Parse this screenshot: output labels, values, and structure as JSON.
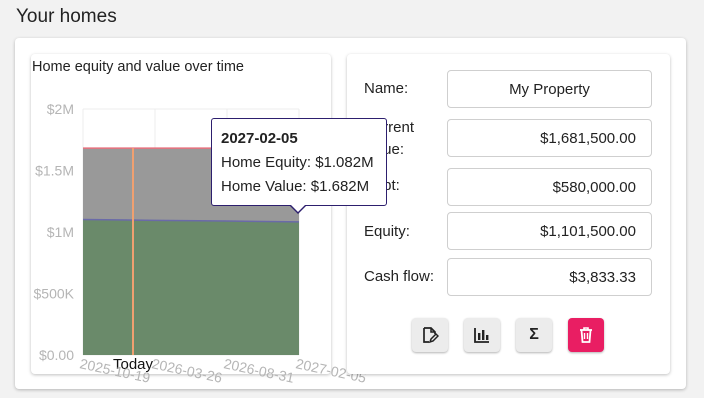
{
  "page": {
    "title": "Your homes"
  },
  "chart_data": {
    "type": "area",
    "title": "Home equity and value over time",
    "x": [
      "2025-10-19",
      "2026-03-26",
      "2026-08-31",
      "2027-02-05"
    ],
    "series": [
      {
        "name": "Home Equity",
        "values": [
          1101500,
          1095000,
          1089000,
          1082000
        ],
        "color": "#6a8a6a"
      },
      {
        "name": "Home Value",
        "values": [
          1681500,
          1681500,
          1681500,
          1682000
        ],
        "color": "#999999"
      }
    ],
    "yticks": [
      "$0.00",
      "$500K",
      "$1M",
      "$1.5M",
      "$2M"
    ],
    "ylim": [
      0,
      2000000
    ],
    "today_marker": {
      "label": "Today",
      "x": "2025-10-19",
      "color": "#f0a070"
    },
    "value_line_color": "#e8707e",
    "equity_line_color": "#6a6aa8",
    "tooltip": {
      "date": "2027-02-05",
      "equity": "Home Equity: $1.082M",
      "value": "Home Value: $1.682M"
    }
  },
  "form": {
    "name_label": "Name:",
    "name_value": "My Property",
    "current_value_label_line1": "Current",
    "current_value_label_line2": "value:",
    "current_value": "$1,681,500.00",
    "debt_label": "Debt:",
    "debt_value": "$580,000.00",
    "equity_label": "Equity:",
    "equity_value": "$1,101,500.00",
    "cashflow_label": "Cash flow:",
    "cashflow_value": "$3,833.33"
  },
  "actions": {
    "edit_icon": "edit-document-icon",
    "chart_icon": "bar-chart-icon",
    "sum_icon": "sigma-icon",
    "delete_icon": "trash-icon",
    "sum_glyph": "Σ",
    "delete_color": "#e91e63"
  }
}
